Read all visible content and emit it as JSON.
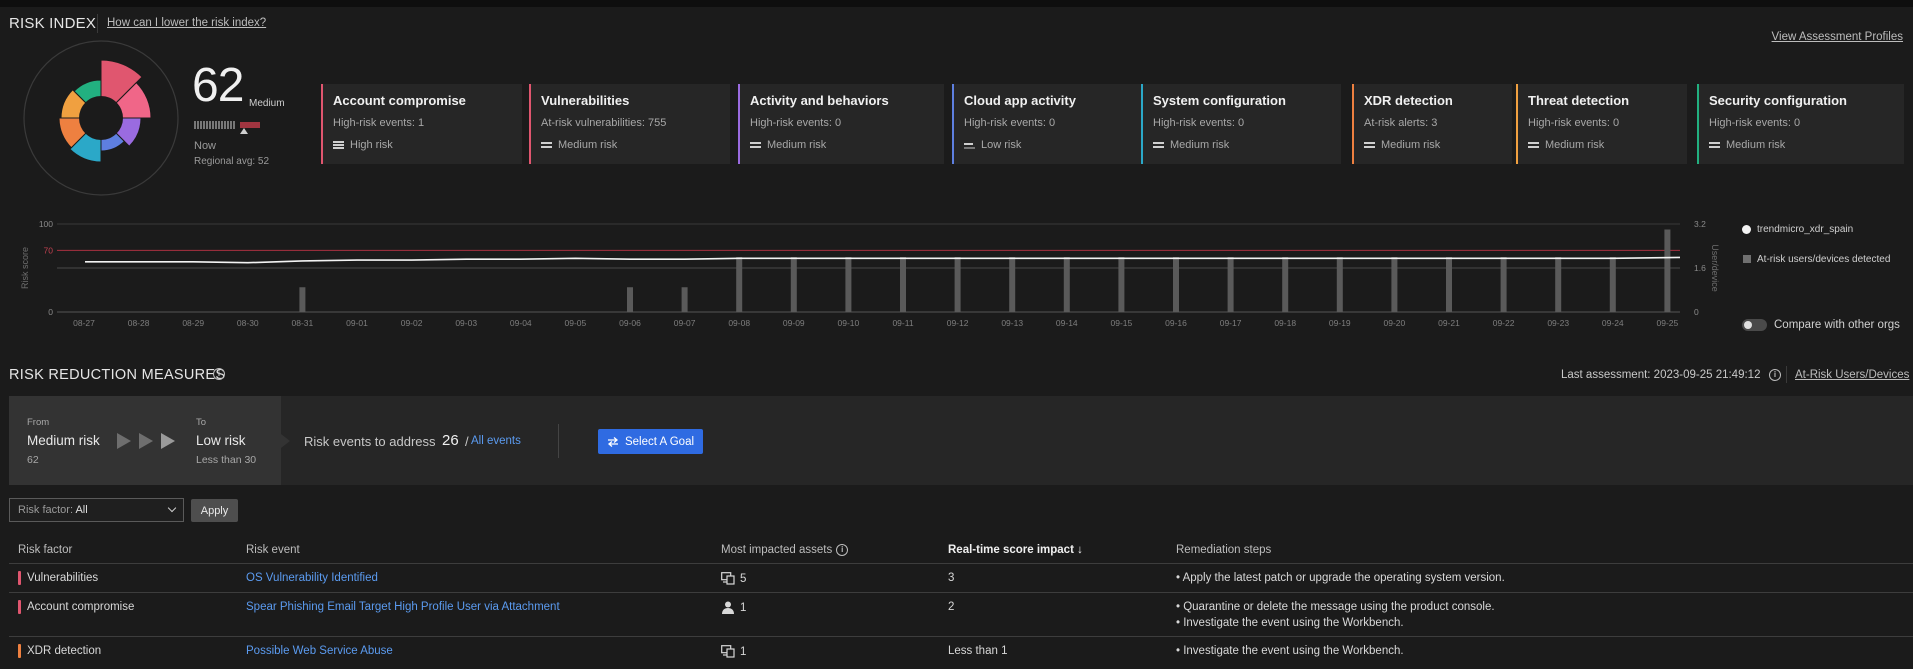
{
  "header": {
    "title": "RISK INDEX",
    "help_link": "How can I lower the risk index?",
    "view_profiles": "View Assessment Profiles"
  },
  "score": {
    "value": "62",
    "level": "Medium",
    "now": "Now",
    "regional_avg": "Regional avg: 52"
  },
  "categories": [
    {
      "title": "Account compromise",
      "stat": "High-risk events: 1",
      "level": "High risk",
      "color": "#e0566f"
    },
    {
      "title": "Vulnerabilities",
      "stat": "At-risk vulnerabilities: 755",
      "level": "Medium risk",
      "color": "#e0566f"
    },
    {
      "title": "Activity and behaviors",
      "stat": "High-risk events: 0",
      "level": "Medium risk",
      "color": "#9a6be0"
    },
    {
      "title": "Cloud app activity",
      "stat": "High-risk events: 0",
      "level": "Low risk",
      "color": "#5e7fe0"
    },
    {
      "title": "System configuration",
      "stat": "High-risk events: 0",
      "level": "Medium risk",
      "color": "#2ba8c8"
    },
    {
      "title": "XDR detection",
      "stat": "At-risk alerts: 3",
      "level": "Medium risk",
      "color": "#ee8040"
    },
    {
      "title": "Threat detection",
      "stat": "High-risk events: 0",
      "level": "Medium risk",
      "color": "#f0a040"
    },
    {
      "title": "Security configuration",
      "stat": "High-risk events: 0",
      "level": "Medium risk",
      "color": "#22b080"
    }
  ],
  "chart_data": {
    "type": "bar",
    "ylabel": "Risk score",
    "y2label": "User/device",
    "ylim": [
      0,
      100
    ],
    "y2lim": [
      0,
      3.2
    ],
    "yticks": [
      "100",
      "70",
      "0"
    ],
    "y2ticks": [
      "3.2",
      "1.6",
      "0"
    ],
    "threshold": 70,
    "categories": [
      "08-27",
      "08-28",
      "08-29",
      "08-30",
      "08-31",
      "09-01",
      "09-02",
      "09-03",
      "09-04",
      "09-05",
      "09-06",
      "09-07",
      "09-08",
      "09-09",
      "09-10",
      "09-11",
      "09-12",
      "09-13",
      "09-14",
      "09-15",
      "09-16",
      "09-17",
      "09-18",
      "09-19",
      "09-20",
      "09-21",
      "09-22",
      "09-23",
      "09-24",
      "09-25"
    ],
    "series": [
      {
        "name": "trendmicro_xdr_spain",
        "kind": "line",
        "values": [
          57,
          57,
          57,
          56,
          58,
          59,
          59,
          60,
          60,
          61,
          60,
          60,
          61,
          61,
          61,
          61,
          61,
          61,
          61,
          61,
          61,
          61,
          61,
          61,
          61,
          61,
          61,
          61,
          61,
          62
        ]
      },
      {
        "name": "At-risk users/devices detected",
        "kind": "bar",
        "axis": "y2",
        "values": [
          0,
          0,
          0,
          0,
          0.9,
          0,
          0,
          0,
          0,
          0,
          0.9,
          0.9,
          2,
          2,
          2,
          2,
          2,
          2,
          2,
          2,
          2,
          2,
          2,
          2,
          2,
          2,
          2,
          2,
          2,
          3
        ]
      }
    ],
    "legend_position": "right",
    "grid": false
  },
  "legend": {
    "toggle_label": "Compare with other orgs"
  },
  "rrm": {
    "title": "RISK REDUCTION MEASURES",
    "last_assessment": "Last assessment: 2023-09-25 21:49:12",
    "at_risk_link": "At-Risk Users/Devices",
    "from_label": "From",
    "from_value": "Medium risk",
    "from_num": "62",
    "to_label": "To",
    "to_value": "Low risk",
    "to_num": "Less than 30",
    "events_label": "Risk events to address",
    "events_count": "26",
    "events_slash": "/",
    "all_events": "All events",
    "goal_button": "Select A Goal"
  },
  "filter": {
    "label": "Risk factor:",
    "value": "All",
    "apply": "Apply"
  },
  "table": {
    "headers": [
      "Risk factor",
      "Risk event",
      "Most impacted assets",
      "Real-time score impact",
      "Remediation steps"
    ],
    "sort_indicator": "↓",
    "rows": [
      {
        "factor": "Vulnerabilities",
        "color": "#e0566f",
        "event": "OS Vulnerability Identified",
        "asset_icon": "device-icon",
        "assets": "5",
        "impact": "3",
        "steps": [
          "• Apply the latest patch or upgrade the operating system version."
        ]
      },
      {
        "factor": "Account compromise",
        "color": "#e0566f",
        "event": "Spear Phishing Email Target High Profile User via Attachment",
        "asset_icon": "user-icon",
        "assets": "1",
        "impact": "2",
        "steps": [
          "• Quarantine or delete the message using the product console.",
          "• Investigate the event using the Workbench."
        ]
      },
      {
        "factor": "XDR detection",
        "color": "#ee8040",
        "event": "Possible Web Service Abuse",
        "asset_icon": "device-icon",
        "assets": "1",
        "impact": "Less than 1",
        "steps": [
          "• Investigate the event using the Workbench."
        ]
      }
    ]
  }
}
